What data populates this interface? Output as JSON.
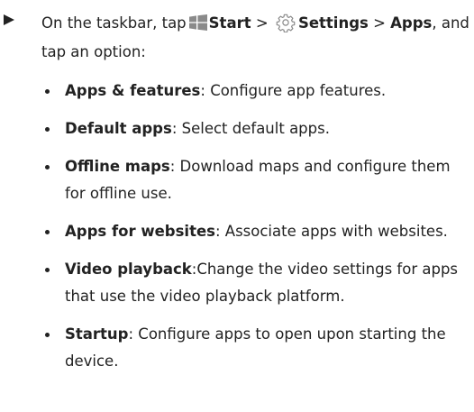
{
  "step": {
    "prefix": "On the taskbar, tap",
    "start_label": "Start",
    "sep1": " > ",
    "settings_label": "Settings",
    "sep2": " > ",
    "apps_label": "Apps",
    "suffix": ", and tap an option:",
    "start_icon": "windows-start-icon",
    "settings_icon": "gear-icon"
  },
  "options": [
    {
      "term": "Apps & features",
      "desc": ": Configure app features."
    },
    {
      "term": "Default apps",
      "desc": ": Select default apps."
    },
    {
      "term": "Offline maps",
      "desc": ": Download maps and configure them for offline use."
    },
    {
      "term": "Apps for websites",
      "desc": ": Associate apps with websites."
    },
    {
      "term": "Video playback",
      "desc": ":Change the video settings for apps that use the video playback platform."
    },
    {
      "term": "Startup",
      "desc": ": Configure apps to open upon starting the device."
    }
  ]
}
